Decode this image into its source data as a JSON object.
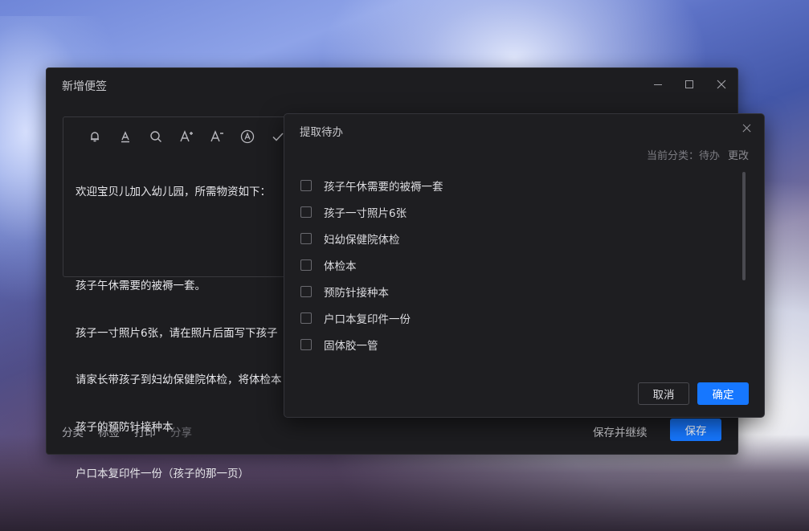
{
  "editor": {
    "title": "新增便签",
    "toolbar": [
      {
        "icon": "bell-icon"
      },
      {
        "icon": "text-format-icon"
      },
      {
        "icon": "search-icon"
      },
      {
        "icon": "font-increase-icon"
      },
      {
        "icon": "font-decrease-icon"
      },
      {
        "icon": "extract-icon"
      },
      {
        "icon": "check-icon"
      }
    ],
    "note_lines": [
      "欢迎宝贝儿加入幼儿园，所需物资如下：",
      "",
      "孩子午休需要的被褥一套。",
      "孩子一寸照片6张，请在照片后面写下孩子",
      "请家长带孩子到妇幼保健院体检，将体检本",
      "孩子的预防针接种本",
      "户口本复印件一份（孩子的那一页）"
    ],
    "bottom_links": [
      "分类",
      "标签",
      "打印",
      "分享"
    ],
    "save_continue": "保存并继续",
    "save": "保存"
  },
  "dialog": {
    "title": "提取待办",
    "category_label": "当前分类：待办",
    "change_label": "更改",
    "items": [
      {
        "label": "孩子午休需要的被褥一套",
        "checked": false
      },
      {
        "label": "孩子一寸照片6张",
        "checked": false
      },
      {
        "label": "妇幼保健院体检",
        "checked": false
      },
      {
        "label": "体检本",
        "checked": false
      },
      {
        "label": "预防针接种本",
        "checked": false
      },
      {
        "label": "户口本复印件一份",
        "checked": false
      },
      {
        "label": "固体胶一管",
        "checked": false
      }
    ],
    "cancel": "取消",
    "ok": "确定"
  },
  "colors": {
    "accent": "#1677ff",
    "window_bg": "#1d1d20",
    "dialog_bg": "#1e1e21"
  }
}
